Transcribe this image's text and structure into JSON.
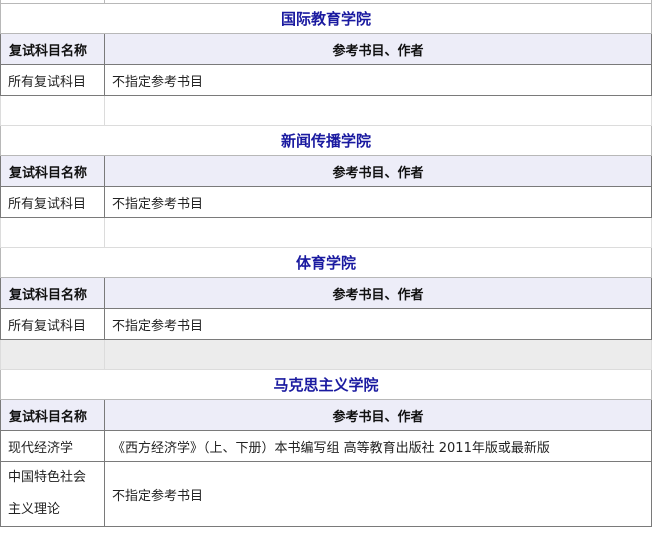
{
  "sections": [
    {
      "title": "国际教育学院",
      "headers": [
        "复试科目名称",
        "参考书目、作者"
      ],
      "rows": [
        {
          "subject": "所有复试科目",
          "books": "不指定参考书目"
        }
      ]
    },
    {
      "title": "新闻传播学院",
      "headers": [
        "复试科目名称",
        "参考书目、作者"
      ],
      "rows": [
        {
          "subject": "所有复试科目",
          "books": "不指定参考书目"
        }
      ]
    },
    {
      "title": "体育学院",
      "headers": [
        "复试科目名称",
        "参考书目、作者"
      ],
      "rows": [
        {
          "subject": "所有复试科目",
          "books": "不指定参考书目"
        }
      ]
    },
    {
      "title": "马克思主义学院",
      "headers": [
        "复试科目名称",
        "参考书目、作者"
      ],
      "rows": [
        {
          "subject": "现代经济学",
          "books": "《西方经济学》（上、下册）本书编写组 高等教育出版社 2011年版或最新版"
        },
        {
          "subject": "中国特色社会主义理论",
          "books": "不指定参考书目"
        }
      ]
    }
  ],
  "colors": {
    "title_text": "#1a1aa0",
    "header_bg": "#ededf8",
    "spacer_gray": "#ececec"
  }
}
